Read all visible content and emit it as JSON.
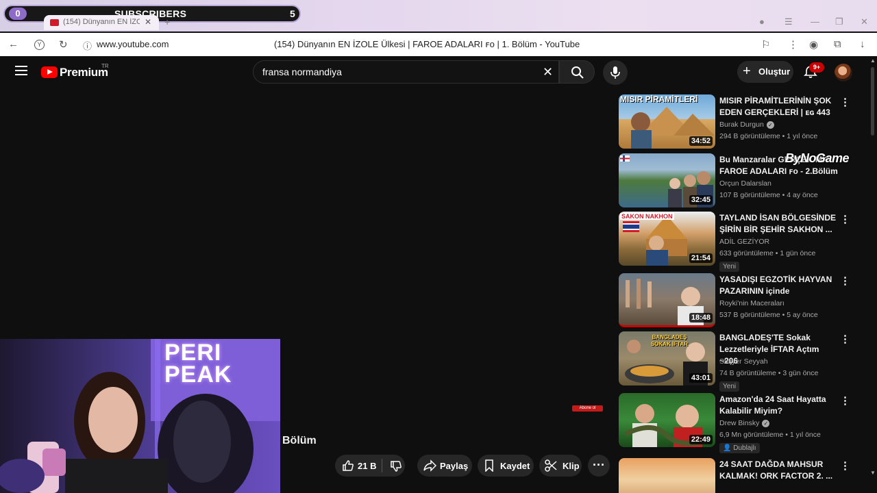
{
  "overlay": {
    "subscribers_label": "SUBSCRIBERS",
    "count_left": "0",
    "count_right": "5"
  },
  "browser": {
    "tab_title": "(154) Dünyanın EN İZOLE",
    "url": "www.youtube.com",
    "page_title": "(154) Dünyanın EN İZOLE Ülkesi | FAROE ADALARI ꜰᴏ | 1. Bölüm - YouTube"
  },
  "header": {
    "logo_text": "Premium",
    "logo_region": "TR",
    "search_value": "fransa normandiya",
    "create_label": "Oluştur",
    "notifications": "9+"
  },
  "video": {
    "title_fragment": "Bölüm",
    "subscribe_badge": "Abone ol",
    "likes": "21 B",
    "share_label": "Paylaş",
    "save_label": "Kaydet",
    "clip_label": "Klip"
  },
  "watermark": "ByNoGame",
  "recommendations": [
    {
      "title": "MISIR PİRAMİTLERİNİN ŞOK EDEN GERÇEKLERİ | ᴇɢ 443",
      "channel": "Burak Durgun",
      "verified": true,
      "meta": "294 B görüntüleme • 1 yıl önce",
      "duration": "34:52",
      "thumb_text": "MISIR PİRAMİTLERİ",
      "badge": ""
    },
    {
      "title": "Bu Manzaralar GERÇEK Mİ? FAROE ADALARI ꜰᴏ - 2.Bölüm",
      "channel": "Orçun Dalarslan",
      "verified": false,
      "meta": "107 B görüntüleme • 4 ay önce",
      "duration": "32:45",
      "thumb_text": "",
      "badge": ""
    },
    {
      "title": "TAYLAND İSAN BÖLGESİNDE ŞİRİN BİR ŞEHİR SAKHON ...",
      "channel": "ADİL GEZİYOR",
      "verified": false,
      "meta": "633 görüntüleme • 1 gün önce",
      "duration": "21:54",
      "thumb_text": "SAKON NAKHON",
      "badge": "Yeni"
    },
    {
      "title": "YASADIŞI EGZOTİK HAYVAN PAZARININ içinde",
      "channel": "Royki'nin Maceraları",
      "verified": false,
      "meta": "537 B görüntüleme • 5 ay önce",
      "duration": "18:48",
      "thumb_text": "",
      "badge": ""
    },
    {
      "title": "BANGLADEŞ'TE Sokak Lezzetleriyle İFTAR Açtım ~206",
      "channel": "Stajyer Seyyah",
      "verified": false,
      "meta": "74 B görüntüleme • 3 gün önce",
      "duration": "43:01",
      "thumb_text": "BANGLADEŞ SOKAK İFTAR",
      "badge": "Yeni"
    },
    {
      "title": "Amazon'da 24 Saat Hayatta Kalabilir Miyim?",
      "channel": "Drew Binsky",
      "verified": true,
      "meta": "6,9 Mn görüntüleme • 1 yıl önce",
      "duration": "22:49",
      "thumb_text": "",
      "badge": "Dublajlı"
    },
    {
      "title": "24 SAAT DAĞDA MAHSUR KALMAK! ORK FACTOR 2. ...",
      "channel": "",
      "verified": false,
      "meta": "",
      "duration": "",
      "thumb_text": "",
      "badge": ""
    }
  ],
  "webcam_sign": "PERI PEAK"
}
